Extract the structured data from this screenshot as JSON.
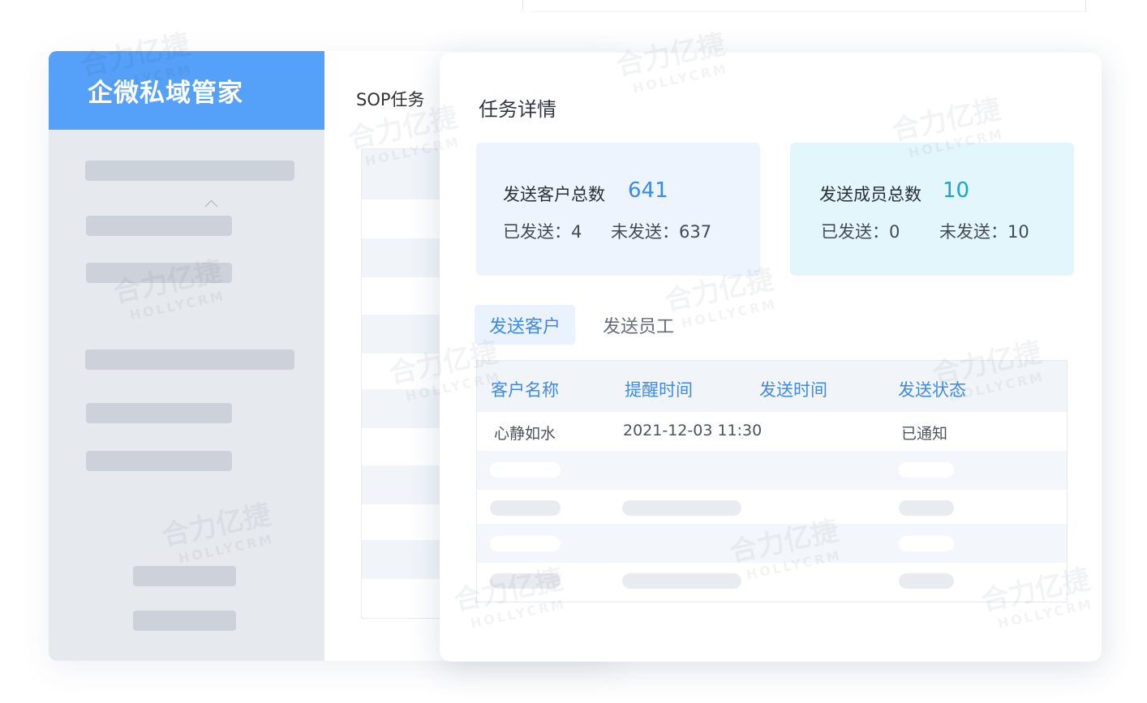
{
  "app": {
    "brand": "企微私域管家",
    "page_title": "SOP任务"
  },
  "detail": {
    "title": "任务详情",
    "customer_stats": {
      "label": "发送客户总数",
      "total": "641",
      "sent_label": "已发送：4",
      "unsent_label": "未发送：637"
    },
    "member_stats": {
      "label": "发送成员总数",
      "total": "10",
      "sent_label": "已发送：0",
      "unsent_label": "未发送：10"
    },
    "tabs": [
      {
        "label": "发送客户",
        "active": true
      },
      {
        "label": "发送员工",
        "active": false
      }
    ],
    "table": {
      "columns": [
        "客户名称",
        "提醒时间",
        "发送时间",
        "发送状态"
      ],
      "rows": [
        {
          "name": "心静如水",
          "remind_time": "2021-12-03 11:30",
          "send_time": "",
          "status": "已通知"
        }
      ]
    }
  },
  "watermark": {
    "cn": "合力亿捷",
    "en": "HOLLYCRM"
  },
  "colors": {
    "brand": "#55a0f8",
    "accent_blue": "#3b8ae6",
    "accent_cyan": "#1aa6c8"
  }
}
